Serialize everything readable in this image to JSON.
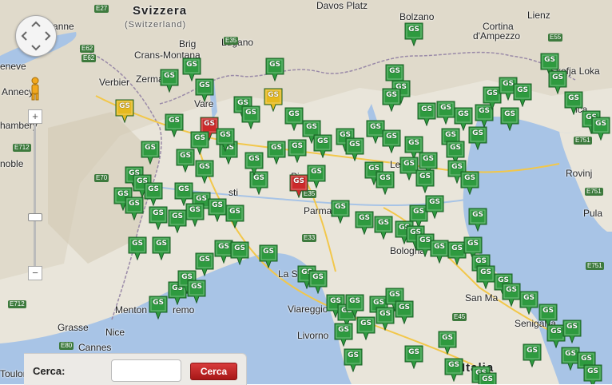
{
  "map": {
    "country_labels": {
      "switzerland": "Svizzera",
      "switzerland_local": "(Switzerland)",
      "italy": "Italia"
    },
    "places": {
      "lausanne": "Lausanne",
      "geneve": "eneve",
      "annecy": "Annecy",
      "chambery": "hambery",
      "grenoble": "noble",
      "verbier": "Verbier",
      "zermatt": "Zermatt",
      "crans": "Crans-Montana",
      "brig": "Brig",
      "lugano": "Lugano",
      "vares": "Vare",
      "davos": "Davos Platz",
      "bolzano": "Bolzano",
      "cortina": "Cortina\nd'Ampezzo",
      "cortina_line1": "Cortina",
      "cortina_line2": "d'Ampezzo",
      "lienz": "Lienz",
      "skofja": "Škofja Loka",
      "parma": "Parma",
      "bologna": "Bologna",
      "laspezia": "La S",
      "viareggio": "Viareggio",
      "livorno": "Livorno",
      "menton": "Menton",
      "sanremo": "remo",
      "grasse": "Grasse",
      "nice": "Nice",
      "cannes": "Cannes",
      "toulon": "Toulon",
      "sanmarino": "San Ma",
      "senigallia": "Senigallia",
      "rovinj": "Rovinj",
      "pula": "Pula",
      "pisa": "Pi",
      "asti": "sti",
      "gorica": "rica",
      "le": "Le",
      "mi": "Ri"
    },
    "roads": [
      "E27",
      "E62",
      "E35",
      "E55",
      "E62",
      "E712",
      "E70",
      "E35",
      "E33",
      "E712",
      "E80",
      "E45",
      "E751",
      "E751",
      "E751"
    ],
    "marker_text": "GS",
    "colors": {
      "marker_green": "#2e9a3f",
      "marker_yellow": "#e6b91e",
      "marker_red": "#cc2a2a",
      "sea": "#a8c4e6",
      "land": "#e8e4d8"
    }
  },
  "controls": {
    "pan_label": "pan-control",
    "zoom_in": "+",
    "zoom_out": "−"
  },
  "search": {
    "label": "Cerca:",
    "input_value": "",
    "button_label": "Cerca"
  }
}
